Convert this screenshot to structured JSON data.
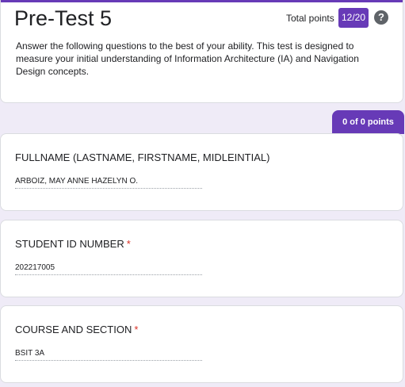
{
  "form": {
    "title": "Pre-Test 5",
    "total_points_label": "Total points",
    "score": "12/20",
    "help_icon": "question-mark-icon",
    "description": "Answer the following questions to the best of your ability. This test is designed to measure your initial understanding of Information Architecture (IA) and Navigation Design concepts."
  },
  "section": {
    "points_badge": "0 of 0 points"
  },
  "questions": [
    {
      "title": "FULLNAME (LASTNAME, FIRSTNAME, MIDLEINTIAL)",
      "required": false,
      "answer": "ARBOIZ, MAY ANNE HAZELYN O."
    },
    {
      "title": "STUDENT ID NUMBER",
      "required": true,
      "required_mark": "*",
      "answer": "202217005"
    },
    {
      "title": "COURSE AND SECTION",
      "required": true,
      "required_mark": "*",
      "answer": "BSIT 3A"
    }
  ],
  "colors": {
    "accent": "#673ab7",
    "background": "#efebf7",
    "required": "#d93025"
  }
}
